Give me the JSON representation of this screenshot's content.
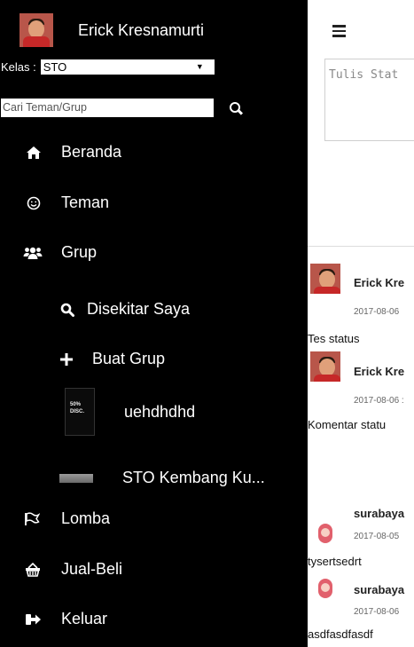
{
  "profile": {
    "name": "Erick Kresnamurti"
  },
  "kelas": {
    "label": "Kelas :",
    "value": "STO"
  },
  "search": {
    "placeholder": "Cari Teman/Grup"
  },
  "menu": {
    "beranda": "Beranda",
    "teman": "Teman",
    "grup": "Grup",
    "disekitar": "Disekitar Saya",
    "buat_grup": "Buat Grup",
    "group1": "uehdhdhd",
    "group1_thumb_text": "50% DISC.",
    "group2": "STO Kembang Ku...",
    "lomba": "Lomba",
    "jual_beli": "Jual-Beli",
    "keluar": "Keluar"
  },
  "main": {
    "status_placeholder": "Tulis Stat",
    "posts": [
      {
        "author": "Erick Kre",
        "time": "2017-08-06",
        "text": "Tes status"
      },
      {
        "author": "Erick Kre",
        "time": "2017-08-06 :",
        "text": "Komentar statu"
      },
      {
        "author": "surabaya",
        "time": "2017-08-05",
        "text": "tysertsedrt"
      },
      {
        "author": "surabaya",
        "time": "2017-08-06",
        "text": "asdfasdfasdf"
      }
    ]
  },
  "icons": [
    "hamburger-icon",
    "home-icon",
    "smiley-icon",
    "users-icon",
    "search-icon",
    "plus-icon",
    "flag-icon",
    "basket-icon",
    "logout-icon"
  ]
}
